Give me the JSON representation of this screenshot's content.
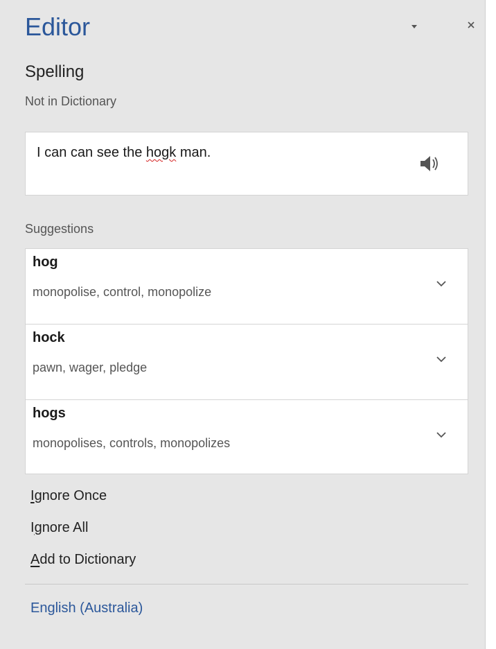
{
  "pane": {
    "title": "Editor"
  },
  "section": {
    "title": "Spelling",
    "subtitle": "Not in Dictionary"
  },
  "context": {
    "before": "I can can see the ",
    "error_word": "hogk",
    "after": " man."
  },
  "suggestions": {
    "label": "Suggestions",
    "items": [
      {
        "word": "hog",
        "synonyms": "monopolise, control, monopolize"
      },
      {
        "word": "hock",
        "synonyms": "pawn, wager, pledge"
      },
      {
        "word": "hogs",
        "synonyms": "monopolises, controls, monopolizes"
      }
    ]
  },
  "actions": {
    "ignore_once": {
      "accel": "I",
      "rest": "gnore Once"
    },
    "ignore_all": {
      "pre": "I",
      "accel": "g",
      "rest": "nore All"
    },
    "add_to_dictionary": {
      "accel": "A",
      "rest": "dd to Dictionary"
    }
  },
  "language": "English (Australia)",
  "colors": {
    "accent": "#2b579a",
    "pane_bg": "#e6e6e6",
    "error_underline": "#d42020"
  }
}
